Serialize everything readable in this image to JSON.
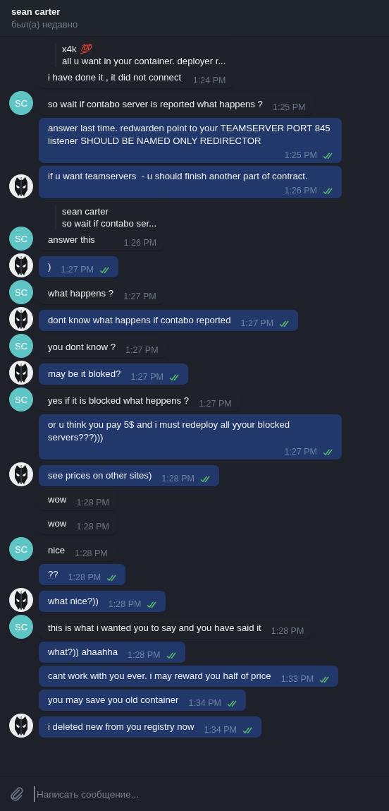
{
  "header": {
    "title": "sean carter",
    "status": "был(а) недавно"
  },
  "messages": [
    {
      "kind": "in",
      "reply": {
        "author": "x4k",
        "author_emoji": "💯",
        "text": "all u want in your container. deployer r..."
      },
      "text": "i have done it , it did not connect",
      "time": "1:24 PM"
    },
    {
      "kind": "in",
      "text": "so wait if contabo server is reported what happens ?",
      "time": "1:25 PM",
      "avatar": {
        "kind": "initials",
        "text": "SC",
        "color": "#5fc4c4"
      }
    },
    {
      "kind": "out",
      "text": "answer last time. redwarden point to your TEAMSERVER PORT 845 listener SHOULD BE NAMED ONLY REDIRECTOR",
      "time": "1:25 PM",
      "read": true
    },
    {
      "kind": "out",
      "text": "if u want teamservers  - u should finish another part of contract.",
      "time": "1:26 PM",
      "read": true,
      "avatar": {
        "kind": "mask"
      }
    },
    {
      "kind": "in",
      "reply": {
        "author": "sean carter",
        "text": "so wait if contabo ser..."
      },
      "text": "answer this",
      "time": "1:26 PM",
      "avatar": {
        "kind": "initials",
        "text": "SC",
        "color": "#5fc4c4"
      }
    },
    {
      "kind": "out",
      "text": ")",
      "time": "1:27 PM",
      "read": true,
      "avatar": {
        "kind": "mask"
      }
    },
    {
      "kind": "in",
      "text": "what happens ?",
      "time": "1:27 PM",
      "avatar": {
        "kind": "initials",
        "text": "SC",
        "color": "#5fc4c4"
      }
    },
    {
      "kind": "out",
      "text": "dont know what happens if contabo reported",
      "time": "1:27 PM",
      "read": true,
      "avatar": {
        "kind": "mask"
      }
    },
    {
      "kind": "in",
      "text": "you dont know ?",
      "time": "1:27 PM",
      "avatar": {
        "kind": "initials",
        "text": "SC",
        "color": "#5fc4c4"
      }
    },
    {
      "kind": "out",
      "text": "may be it bloked?",
      "time": "1:27 PM",
      "read": true,
      "avatar": {
        "kind": "mask"
      }
    },
    {
      "kind": "in",
      "text": "yes if it is blocked what heppens ?",
      "time": "1:27 PM",
      "avatar": {
        "kind": "initials",
        "text": "SC",
        "color": "#5fc4c4"
      }
    },
    {
      "kind": "out",
      "text": "or u think you pay 5$ and i must redeploy all yyour blocked servers???)))",
      "time": "1:27 PM",
      "read": true
    },
    {
      "kind": "out",
      "text": "see prices on other sites)",
      "time": "1:28 PM",
      "read": true,
      "avatar": {
        "kind": "mask"
      }
    },
    {
      "kind": "in",
      "text": "wow",
      "time": "1:28 PM"
    },
    {
      "kind": "in",
      "text": "wow",
      "time": "1:28 PM"
    },
    {
      "kind": "in",
      "text": "nice",
      "time": "1:28 PM",
      "avatar": {
        "kind": "initials",
        "text": "SC",
        "color": "#5fc4c4"
      }
    },
    {
      "kind": "out",
      "text": "??",
      "time": "1:28 PM",
      "read": true
    },
    {
      "kind": "out",
      "text": "what nice?))",
      "time": "1:28 PM",
      "read": true,
      "avatar": {
        "kind": "mask"
      }
    },
    {
      "kind": "in",
      "text": "this is what i wanted you to say and you have said it",
      "time": "1:28 PM",
      "avatar": {
        "kind": "initials",
        "text": "SC",
        "color": "#5fc4c4"
      }
    },
    {
      "kind": "out",
      "text": "what?)) ahaahha",
      "time": "1:28 PM",
      "read": true
    },
    {
      "kind": "out",
      "text": "cant work with you ever. i may reward you half of price",
      "time": "1:33 PM",
      "read": true
    },
    {
      "kind": "out",
      "text": "you may save you old container",
      "time": "1:34 PM",
      "read": true
    },
    {
      "kind": "out",
      "text": "i deleted new from you registry now",
      "time": "1:34 PM",
      "read": true,
      "avatar": {
        "kind": "mask"
      }
    }
  ],
  "composer": {
    "placeholder": "Написать сообщение..."
  }
}
